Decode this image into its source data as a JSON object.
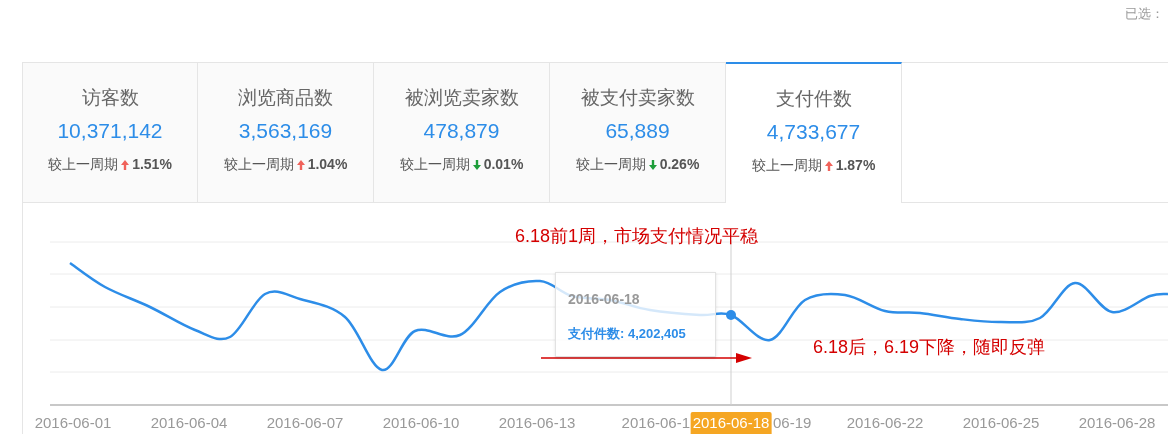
{
  "selected_label": "已选：",
  "metrics": [
    {
      "title": "访客数",
      "value": "10,371,142",
      "compare": "较上一周期",
      "kind": "up",
      "change": "1.51%",
      "selected": false
    },
    {
      "title": "浏览商品数",
      "value": "3,563,169",
      "compare": "较上一周期",
      "kind": "up",
      "change": "1.04%",
      "selected": false
    },
    {
      "title": "被浏览卖家数",
      "value": "478,879",
      "compare": "较上一周期",
      "kind": "down",
      "change": "0.01%",
      "selected": false
    },
    {
      "title": "被支付卖家数",
      "value": "65,889",
      "compare": "较上一周期",
      "kind": "down",
      "change": "0.26%",
      "selected": false
    },
    {
      "title": "支付件数",
      "value": "4,733,677",
      "compare": "较上一周期",
      "kind": "up",
      "change": "1.87%",
      "selected": true
    }
  ],
  "chart": {
    "x_ticks": [
      {
        "label": "2016-06-01",
        "selected": false
      },
      {
        "label": "2016-06-04",
        "selected": false
      },
      {
        "label": "2016-06-07",
        "selected": false
      },
      {
        "label": "2016-06-10",
        "selected": false
      },
      {
        "label": "2016-06-13",
        "selected": false
      },
      {
        "label": "2016-06-1",
        "selected": false
      },
      {
        "label": "2016-06-18",
        "selected": true
      },
      {
        "label": "06-19",
        "selected": false
      },
      {
        "label": "2016-06-22",
        "selected": false
      },
      {
        "label": "2016-06-25",
        "selected": false
      },
      {
        "label": "2016-06-28",
        "selected": false
      }
    ],
    "tooltip": {
      "date": "2016-06-18",
      "label": "支付件数: 4,202,405"
    },
    "annotations": [
      "6.18前1周，市场支付情况平稳",
      "6.18后，6.19下降，随即反弹"
    ]
  }
}
